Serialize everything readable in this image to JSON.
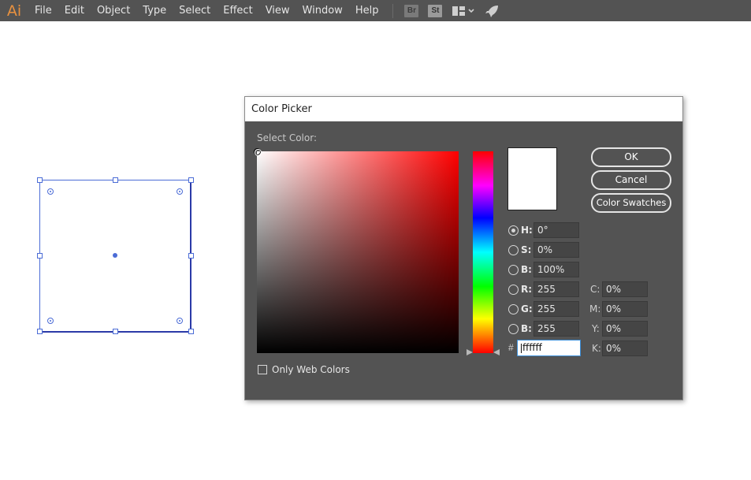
{
  "app": {
    "logo": "Ai"
  },
  "menu": {
    "items": [
      "File",
      "Edit",
      "Object",
      "Type",
      "Select",
      "Effect",
      "View",
      "Window",
      "Help"
    ]
  },
  "toolbar": {
    "bridge_label": "Br",
    "stock_label": "St"
  },
  "dialog": {
    "title": "Color Picker",
    "select_color_label": "Select Color:",
    "preview_color": "#ffffff",
    "buttons": {
      "ok": "OK",
      "cancel": "Cancel",
      "swatches": "Color Swatches"
    },
    "hsb": {
      "h": {
        "label": "H:",
        "value": "0°",
        "checked": true
      },
      "s": {
        "label": "S:",
        "value": "0%"
      },
      "b": {
        "label": "B:",
        "value": "100%"
      }
    },
    "rgb": {
      "r": {
        "label": "R:",
        "value": "255"
      },
      "g": {
        "label": "G:",
        "value": "255"
      },
      "b": {
        "label": "B:",
        "value": "255"
      }
    },
    "cmyk": {
      "c": {
        "label": "C:",
        "value": "0%"
      },
      "m": {
        "label": "M:",
        "value": "0%"
      },
      "y": {
        "label": "Y:",
        "value": "0%"
      },
      "k": {
        "label": "K:",
        "value": "0%"
      }
    },
    "hex": {
      "label": "#",
      "value": "ffffff"
    },
    "web_colors": {
      "label": "Only Web Colors",
      "checked": false
    }
  },
  "colors": {
    "menubar": "#535353",
    "dialog_bg": "#535353",
    "selection": "#4b6cd6",
    "accent": "#e8913f"
  }
}
